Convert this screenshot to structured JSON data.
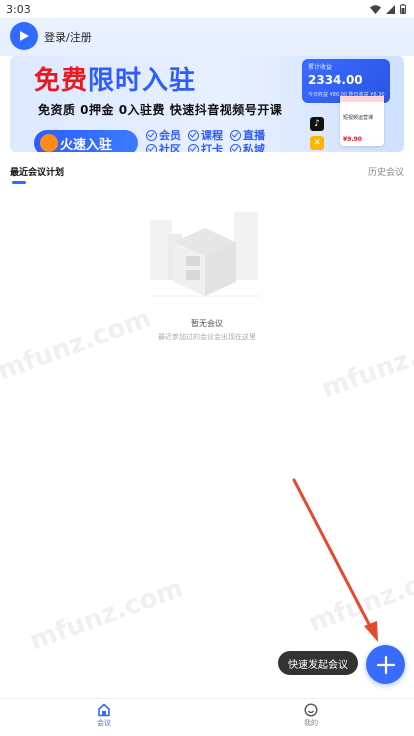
{
  "status_bar": {
    "time": "3:03"
  },
  "header": {
    "login_label": "登录/注册"
  },
  "banner": {
    "title_red": "免费",
    "title_blue": "限时入驻",
    "subtitle": "免资质  0押金  0入驻费  快速抖音视频号开课",
    "cta_label": "火速入驻",
    "perks": [
      "会员",
      "课程",
      "直播",
      "社区",
      "打卡",
      "私域"
    ],
    "card_label": "累计收益",
    "card_amount": "2334.00",
    "card_mini": "今日收益 ¥86.00  昨日收益 ¥8.30",
    "shop_text": "短视频运营课",
    "shop_price": "¥9.90"
  },
  "tabs": {
    "recent": "最近会议计划",
    "history": "历史会议"
  },
  "empty_state": {
    "title": "暂无会议",
    "subtitle": "最近参加过的会议会出现在这里"
  },
  "watermark": "mfunz.com",
  "fab": {
    "tooltip": "快速发起会议"
  },
  "bottom_nav": {
    "meeting": "会议",
    "mine": "我的"
  },
  "colors": {
    "accent": "#2f6bff",
    "red": "#e8191f",
    "tooltip_bg": "#333333"
  }
}
